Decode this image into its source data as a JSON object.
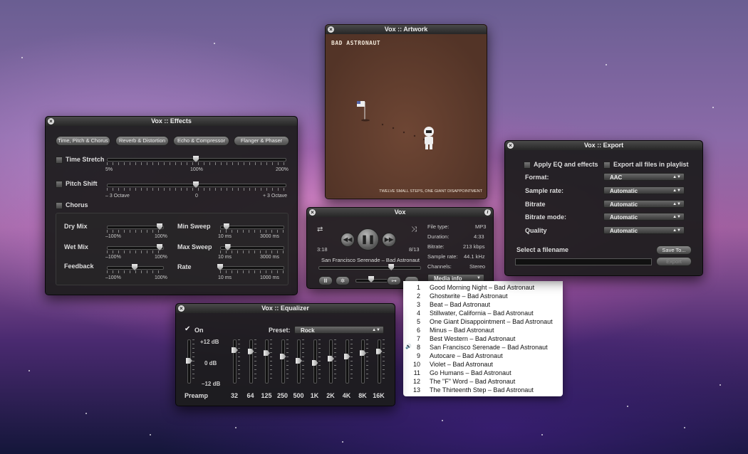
{
  "effects": {
    "title": "Vox :: Effects",
    "tabs": [
      "Time, Pitch & Chorus",
      "Reverb & Distortion",
      "Echo & Compressor",
      "Flanger & Phaser"
    ],
    "time_stretch": {
      "label": "Time Stretch",
      "min": "5%",
      "mid": "100%",
      "max": "200%",
      "value": 0.5
    },
    "pitch_shift": {
      "label": "Pitch Shift",
      "min": "– 3 Octave",
      "mid": "0",
      "max": "+ 3 Octave",
      "value": 0.5
    },
    "chorus": {
      "label": "Chorus",
      "dry_mix": {
        "label": "Dry Mix",
        "min": "–100%",
        "max": "100%",
        "value": 0.95
      },
      "wet_mix": {
        "label": "Wet Mix",
        "min": "–100%",
        "max": "100%",
        "value": 0.95
      },
      "feedback": {
        "label": "Feedback",
        "min": "–100%",
        "max": "100%",
        "value": 0.5
      },
      "min_sweep": {
        "label": "Min Sweep",
        "min": "10 ms",
        "max": "3000 ms",
        "value": 0.1
      },
      "max_sweep": {
        "label": "Max Sweep",
        "min": "10 ms",
        "max": "3000 ms",
        "value": 0.12
      },
      "rate": {
        "label": "Rate",
        "min": "10 ms",
        "max": "1000 ms",
        "value": 0.0
      }
    }
  },
  "artwork": {
    "title": "Vox :: Artwork",
    "band": "BAD ASTRONAUT",
    "album": "TWELVE SMALL STEPS, ONE GIANT DISAPPOINTMENT"
  },
  "player": {
    "title": "Vox",
    "elapsed": "3:18",
    "track_pos": "8/13",
    "now_playing": "San Francisco Serenade – Bad Astronaut",
    "progress": 0.72,
    "volume": 0.5,
    "media_info_label": "Media info",
    "info": [
      {
        "k": "File type:",
        "v": "MP3"
      },
      {
        "k": "Duration:",
        "v": "4:33"
      },
      {
        "k": "Bitrate:",
        "v": "213 kbps"
      },
      {
        "k": "Sample rate:",
        "v": "44.1 kHz"
      },
      {
        "k": "Channels:",
        "v": "Stereo"
      }
    ]
  },
  "export": {
    "title": "Vox :: Export",
    "apply_eq": "Apply EQ and effects",
    "export_all": "Export all files in playlist",
    "rows": [
      {
        "label": "Format:",
        "value": "AAC"
      },
      {
        "label": "Sample rate:",
        "value": "Automatic"
      },
      {
        "label": "Bitrate",
        "value": "Automatic"
      },
      {
        "label": "Bitrate mode:",
        "value": "Automatic"
      },
      {
        "label": "Quality",
        "value": "Automatic"
      }
    ],
    "select_filename": "Select a filename",
    "save_to": "Save To...",
    "export_btn": "Export"
  },
  "equalizer": {
    "title": "Vox :: Equalizer",
    "on_label": "On",
    "preset_label": "Preset:",
    "preset_value": "Rock",
    "db_high": "+12 dB",
    "db_mid": "0 dB",
    "db_low": "–12 dB",
    "preamp": "Preamp",
    "preamp_value": 0.5,
    "bands": [
      "32",
      "64",
      "125",
      "250",
      "500",
      "1K",
      "2K",
      "4K",
      "8K",
      "16K"
    ],
    "band_values": [
      0.75,
      0.72,
      0.68,
      0.6,
      0.5,
      0.45,
      0.55,
      0.6,
      0.68,
      0.72
    ]
  },
  "playlist": {
    "current_index": 7,
    "tracks": [
      {
        "n": "1",
        "t": "Good Morning Night – Bad Astronaut"
      },
      {
        "n": "2",
        "t": "Ghostwrite – Bad Astronaut"
      },
      {
        "n": "3",
        "t": "Beat – Bad Astronaut"
      },
      {
        "n": "4",
        "t": "Stillwater, California – Bad Astronaut"
      },
      {
        "n": "5",
        "t": "One Giant Disappointment – Bad Astronaut"
      },
      {
        "n": "6",
        "t": "Minus – Bad Astronaut"
      },
      {
        "n": "7",
        "t": "Best Western – Bad Astronaut"
      },
      {
        "n": "8",
        "t": "San Francisco Serenade – Bad Astronaut"
      },
      {
        "n": "9",
        "t": "Autocare – Bad Astronaut"
      },
      {
        "n": "10",
        "t": "Violet – Bad Astronaut"
      },
      {
        "n": "11",
        "t": "Go Humans – Bad Astronaut"
      },
      {
        "n": "12",
        "t": "The \"F\" Word – Bad Astronaut"
      },
      {
        "n": "13",
        "t": "The Thirteenth Step – Bad Astronaut"
      }
    ]
  }
}
